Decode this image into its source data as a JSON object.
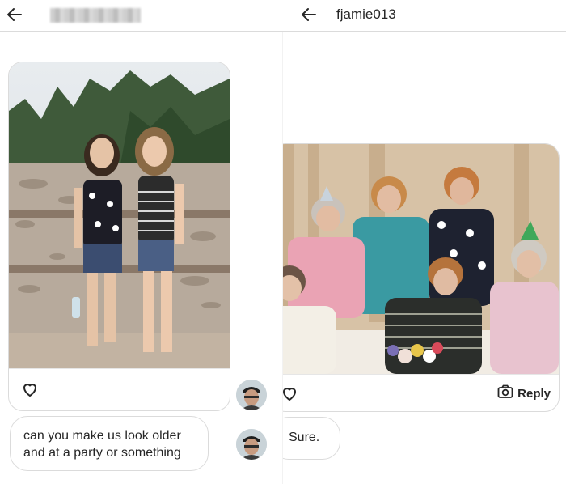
{
  "left_thread": {
    "header": {
      "back_icon": "arrow-left-icon",
      "username_redacted": true
    },
    "photo": {
      "description_icon": "photo-original"
    },
    "like_icon": "heart-icon",
    "message": "can you make us look older and at a party or something"
  },
  "right_thread": {
    "header": {
      "back_icon": "arrow-left-icon",
      "username": "fjamie013"
    },
    "photo": {
      "description_icon": "photo-edited"
    },
    "like_icon": "heart-icon",
    "reply_icon": "camera-icon",
    "reply_label": "Reply",
    "message": "Sure."
  },
  "colors": {
    "border": "#dbdbdb",
    "text": "#262626",
    "background": "#ffffff"
  }
}
